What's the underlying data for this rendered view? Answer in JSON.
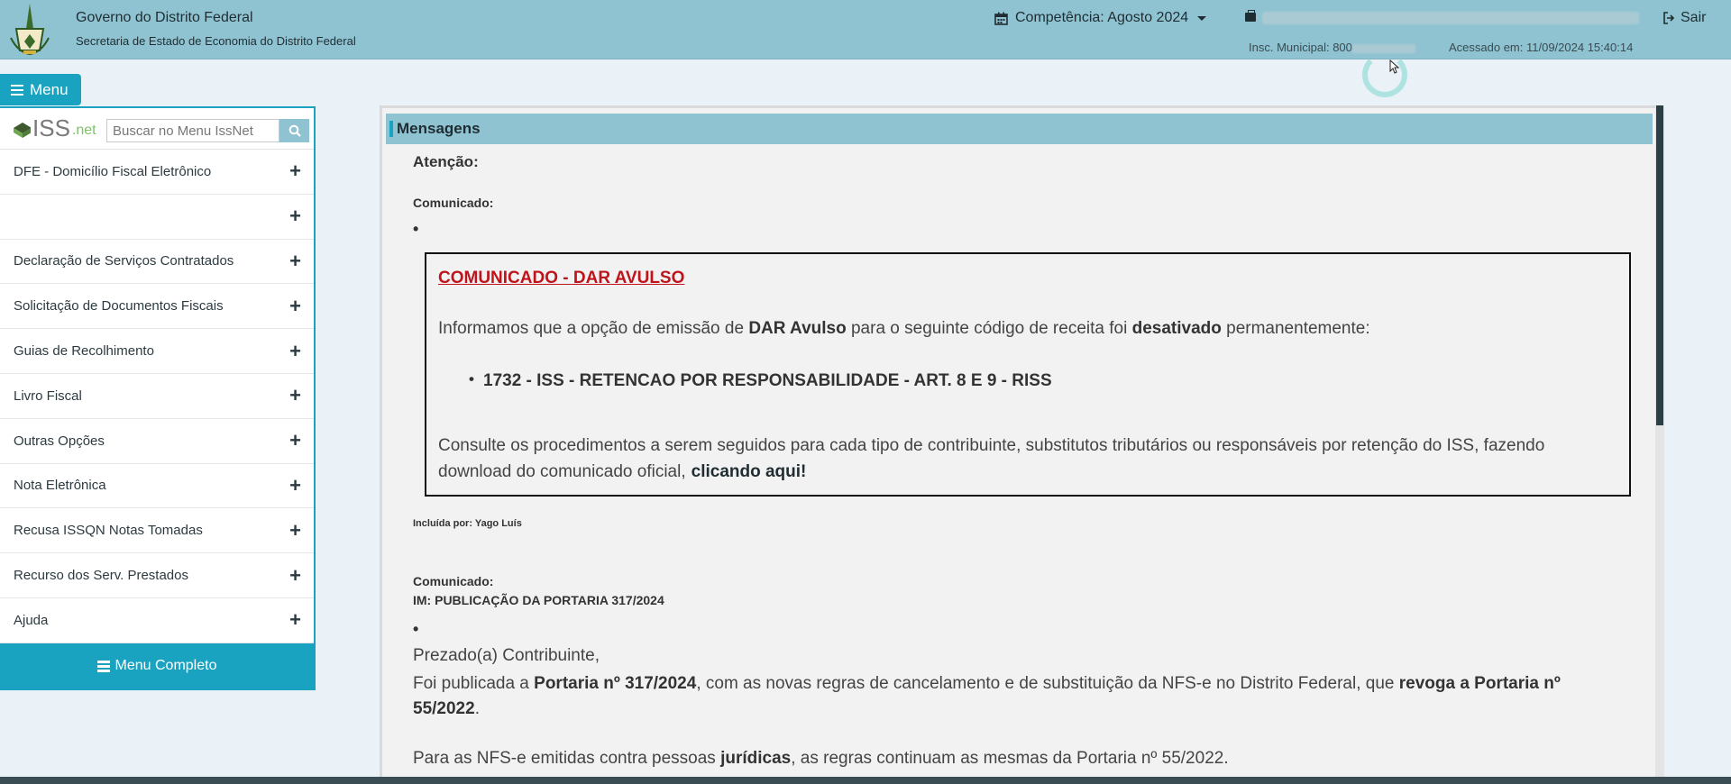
{
  "header": {
    "gov_title": "Governo do Distrito Federal",
    "gov_subtitle": "Secretaria de Estado de Economia do Distrito Federal",
    "competencia": "Competência: Agosto 2024",
    "sair": "Sair",
    "insc_municipal": "Insc. Municipal: 800",
    "acessado_em": "Acessado em: 11/09/2024 15:40:14"
  },
  "menu_button": "Menu",
  "sidebar": {
    "logo_iss": "ISS",
    "logo_net": ".net",
    "search_placeholder": "Buscar no Menu IssNet",
    "items": [
      {
        "label": "DFE - Domicílio Fiscal Eletrônico"
      },
      {
        "label": ""
      },
      {
        "label": "Declaração de Serviços Contratados"
      },
      {
        "label": "Solicitação de Documentos Fiscais"
      },
      {
        "label": "Guias de Recolhimento"
      },
      {
        "label": "Livro Fiscal"
      },
      {
        "label": "Outras Opções"
      },
      {
        "label": "Nota Eletrônica"
      },
      {
        "label": "Recusa ISSQN Notas Tomadas"
      },
      {
        "label": "Recurso dos Serv. Prestados"
      },
      {
        "label": "Ajuda"
      }
    ],
    "plus_symbol": "+",
    "menu_completo": "Menu Completo"
  },
  "panel": {
    "title": "Mensagens",
    "atencao": "Atenção:",
    "comunicado_label": "Comunicado:",
    "bullet": "•",
    "box": {
      "title": "COMUNICADO - DAR AVULSO",
      "p1_a": "Informamos que a opção de emissão de ",
      "p1_b": "DAR Avulso",
      "p1_c": " para o seguinte código de receita foi ",
      "p1_d": "desativado",
      "p1_e": " permanentemente:",
      "list_item": "1732 - ISS - RETENCAO POR RESPONSABILIDADE - ART. 8 E 9 - RISS",
      "p2": "Consulte os procedimentos a serem seguidos para cada tipo de contribuinte, substitutos tributários ou responsáveis por retenção do ISS, fazendo download do comunicado oficial,",
      "link": "clicando aqui!"
    },
    "incluida_por": "Incluída por: Yago Luís",
    "comunicado2_label": "Comunicado:",
    "comunicado2_title": "IM: PUBLICAÇÃO DA PORTARIA 317/2024",
    "prezado": "Prezado(a) Contribuinte,",
    "foi_a": "Foi publicada a ",
    "foi_b": "Portaria nº 317/2024",
    "foi_c": ", com as novas regras de cancelamento e de substituição da NFS-e no Distrito Federal, que ",
    "foi_d": "revoga a Portaria nº 55/2022",
    "foi_e": ".",
    "para_a": "Para as NFS-e emitidas contra pessoas ",
    "para_b": "jurídicas",
    "para_c": ", as regras continuam as mesmas da Portaria nº 55/2022."
  },
  "colors": {
    "header_bg": "#8fc3d1",
    "accent": "#1aa3c0",
    "alert_red": "#c0141c"
  }
}
